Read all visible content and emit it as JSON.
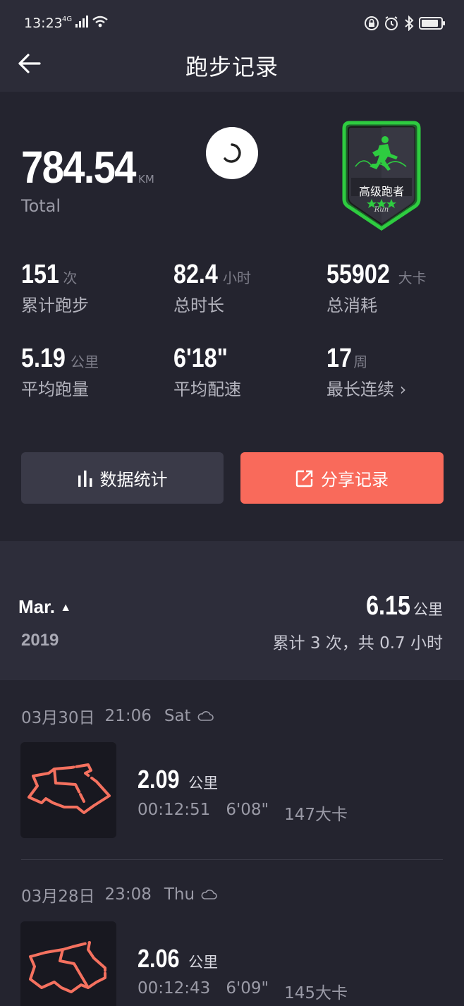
{
  "status": {
    "time": "13:23",
    "network": "4G"
  },
  "header": {
    "title": "跑步记录"
  },
  "summary": {
    "total_value": "784.54",
    "total_unit": "KM",
    "total_label": "Total",
    "badge_text": "高级跑者",
    "badge_sub": "Run",
    "stats": [
      {
        "value": "151",
        "unit": "次",
        "label": "累计跑步"
      },
      {
        "value": "82.4",
        "unit": "小时",
        "label": "总时长"
      },
      {
        "value": "55902",
        "unit": "大卡",
        "label": "总消耗"
      },
      {
        "value": "5.19",
        "unit": "公里",
        "label": "平均跑量"
      },
      {
        "value": "6'18\"",
        "unit": "",
        "label": "平均配速"
      },
      {
        "value": "17",
        "unit": "周",
        "label": "最长连续"
      }
    ],
    "btn_stats": "数据统计",
    "btn_share": "分享记录"
  },
  "month": {
    "name": "Mar.",
    "year": "2019",
    "distance": "6.15",
    "distance_unit": "公里",
    "summary": "累计 3 次，共 0.7 小时"
  },
  "records": [
    {
      "date": "03月30日",
      "time": "21:06",
      "weekday": "Sat",
      "distance": "2.09",
      "unit": "公里",
      "duration": "00:12:51",
      "pace": "6'08\"",
      "calories": "147大卡"
    },
    {
      "date": "03月28日",
      "time": "23:08",
      "weekday": "Thu",
      "distance": "2.06",
      "unit": "公里",
      "duration": "00:12:43",
      "pace": "6'09\"",
      "calories": "145大卡"
    }
  ],
  "colors": {
    "accent": "#f96a5b",
    "badge_green": "#2ecc40",
    "background": "#24242f"
  }
}
